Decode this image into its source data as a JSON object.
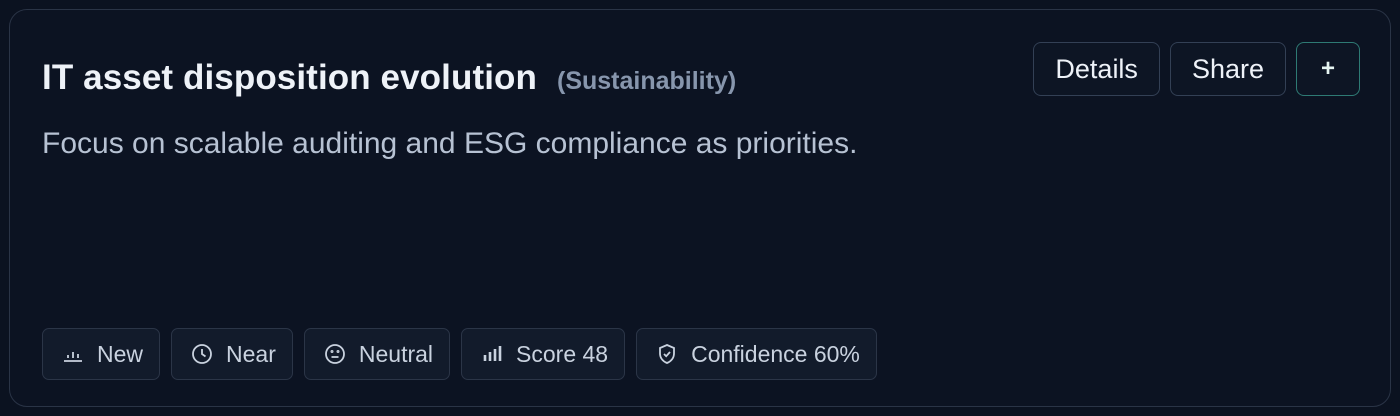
{
  "card": {
    "title": "IT asset disposition evolution",
    "category": "(Sustainability)",
    "description": "Focus on scalable auditing and ESG compliance as priorities."
  },
  "actions": {
    "details_label": "Details",
    "share_label": "Share",
    "add_label": "+"
  },
  "badges": {
    "status": {
      "label": "New",
      "icon": "bar-chart-icon"
    },
    "horizon": {
      "label": "Near",
      "icon": "clock-icon"
    },
    "sentiment": {
      "label": "Neutral",
      "icon": "neutral-face-icon"
    },
    "score": {
      "label": "Score 48",
      "icon": "signal-bars-icon"
    },
    "confidence": {
      "label": "Confidence 60%",
      "icon": "shield-icon"
    }
  },
  "colors": {
    "background": "#0b1220",
    "card_border": "#2a3446",
    "accent_teal": "#2e7a74",
    "title_text": "#eef2f8",
    "muted_text": "#8796ad"
  }
}
